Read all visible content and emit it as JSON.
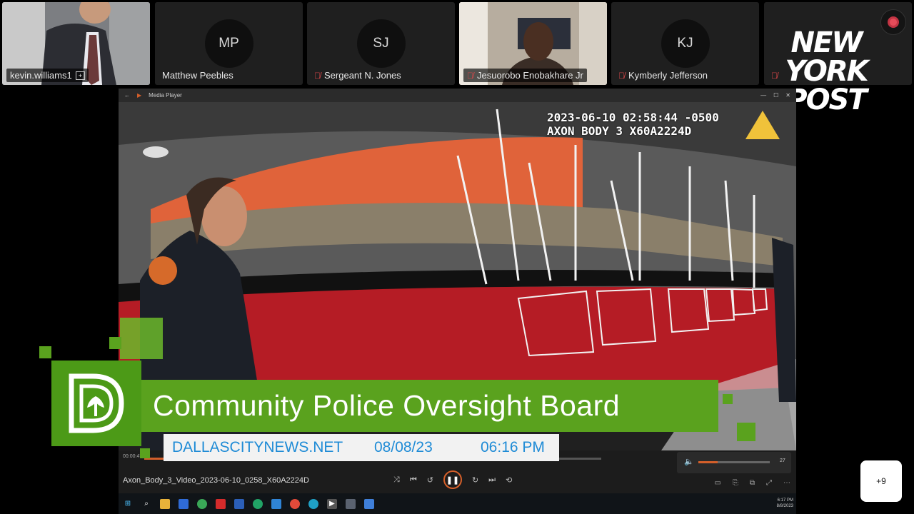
{
  "participants": [
    {
      "name": "kevin.williams1",
      "initials": "",
      "video": true,
      "muted": false,
      "badge": "+"
    },
    {
      "name": "Matthew Peebles",
      "initials": "MP",
      "video": false,
      "muted": false
    },
    {
      "name": "Sergeant N. Jones",
      "initials": "SJ",
      "video": false,
      "muted": true
    },
    {
      "name": "Jesuorobo Enobakhare Jr",
      "initials": "",
      "video": true,
      "muted": true
    },
    {
      "name": "Kymberly Jefferson",
      "initials": "KJ",
      "video": false,
      "muted": true
    },
    {
      "name": "",
      "initials": "",
      "video": false,
      "muted": true
    }
  ],
  "logo": {
    "line1": "NEW",
    "line2": "YORK",
    "line3": "POST"
  },
  "player": {
    "window_title": "Media Player",
    "bodycam_line1": "2023-06-10 02:58:44 -0500",
    "bodycam_line2": "AXON BODY 3 X60A2224D",
    "filename": "Axon_Body_3_Video_2023-06-10_0258_X60A2224D",
    "elapsed": "00:00:47",
    "progress": 0.83,
    "volume_value": "27",
    "volume_level": 0.27
  },
  "lower_third": {
    "title": "Community Police Oversight Board",
    "site": "DALLASCITYNEWS.NET",
    "date": "08/08/23",
    "time": "06:16 PM"
  },
  "taskbar": {
    "clock_time": "6:17 PM",
    "clock_date": "8/8/2023"
  },
  "more_participants": "+9",
  "colors": {
    "brand_green": "#5aa21e",
    "accent_orange": "#d45f2a",
    "record_red": "#e64c5a",
    "link_blue": "#1e8bd6"
  }
}
